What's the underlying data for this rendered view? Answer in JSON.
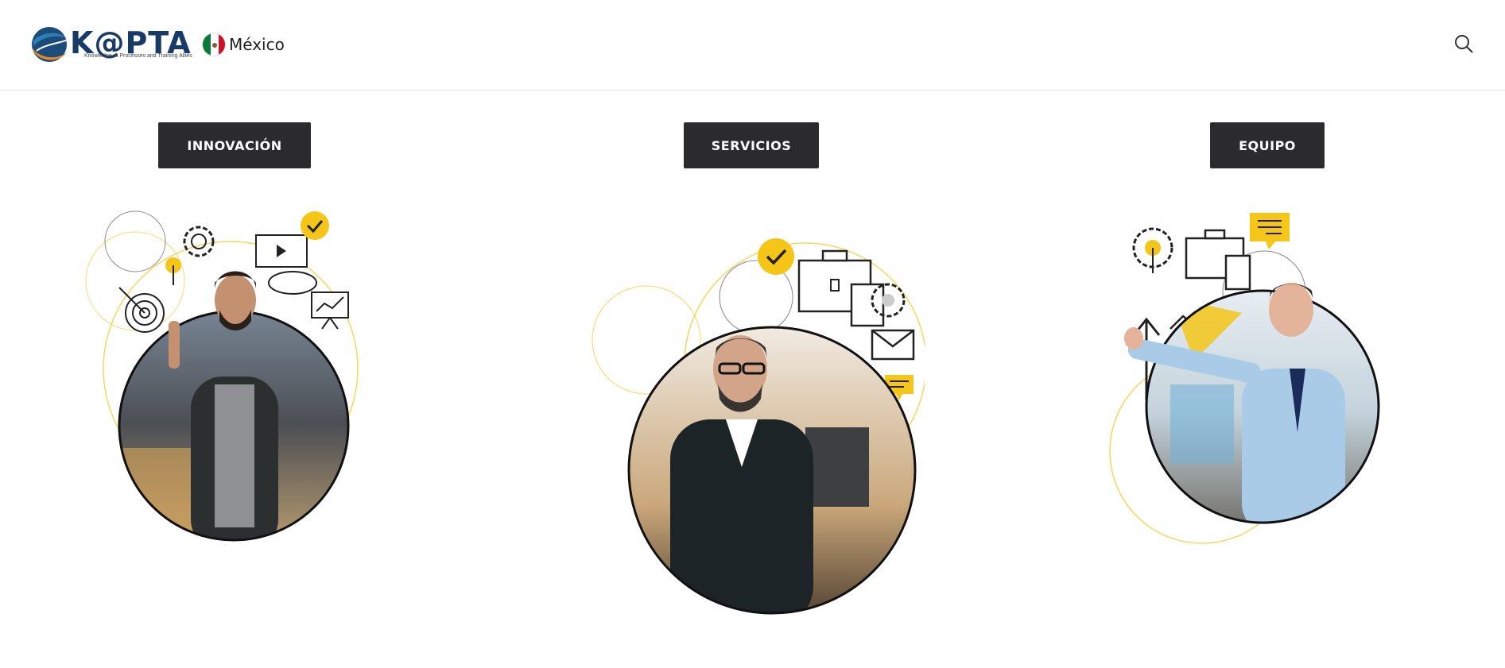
{
  "header": {
    "logo": {
      "wordmark": "K@PTA",
      "tagline": "Knowledge at Processes and Training Allies"
    },
    "country": "México",
    "flag_icon": "mexico-flag-icon",
    "search_icon": "search-icon"
  },
  "sections": [
    {
      "label": "INNOVACIÓN",
      "illustration": "person-idea-illustration"
    },
    {
      "label": "SERVICIOS",
      "illustration": "businessman-briefcase-illustration"
    },
    {
      "label": "EQUIPO",
      "illustration": "team-presenter-illustration"
    }
  ],
  "colors": {
    "brand_navy": "#173a67",
    "brand_orange": "#f08a1c",
    "accent_yellow": "#f5c518",
    "button_dark": "#2b2b2d"
  }
}
